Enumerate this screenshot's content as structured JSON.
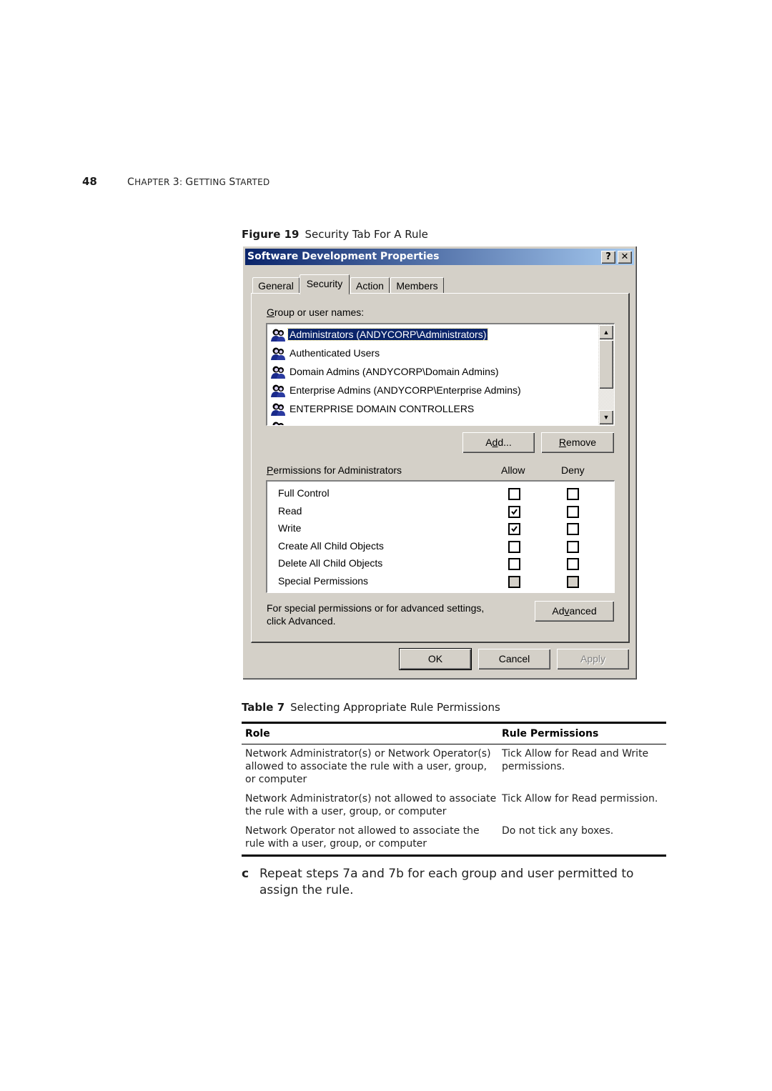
{
  "header": {
    "page_number": "48",
    "chapter_text": "Chapter 3: Getting Started"
  },
  "figure": {
    "label": "Figure 19",
    "title": "Security Tab For A Rule"
  },
  "dialog": {
    "title": "Software Development Properties",
    "help_button": "?",
    "close_button": "✕",
    "tabs": [
      {
        "label": "General",
        "active": false
      },
      {
        "label": "Security",
        "active": true
      },
      {
        "label": "Action",
        "active": false
      },
      {
        "label": "Members",
        "active": false
      }
    ],
    "group_label": "Group or user names:",
    "group_label_mnemonic": "G",
    "users": [
      {
        "name": "Administrators (ANDYCORP\\Administrators)",
        "selected": true,
        "icon": "user-group-icon"
      },
      {
        "name": "Authenticated Users",
        "selected": false,
        "icon": "user-group-icon"
      },
      {
        "name": "Domain Admins (ANDYCORP\\Domain Admins)",
        "selected": false,
        "icon": "user-group-icon"
      },
      {
        "name": "Enterprise Admins (ANDYCORP\\Enterprise Admins)",
        "selected": false,
        "icon": "user-group-icon"
      },
      {
        "name": "ENTERPRISE DOMAIN CONTROLLERS",
        "selected": false,
        "icon": "user-group-icon"
      }
    ],
    "add_button": "Add...",
    "remove_button": "Remove",
    "permissions_label": "Permissions for Administrators",
    "allow_header": "Allow",
    "deny_header": "Deny",
    "permissions": [
      {
        "name": "Full Control",
        "allow": "unchecked",
        "deny": "unchecked"
      },
      {
        "name": "Read",
        "allow": "checked",
        "deny": "unchecked"
      },
      {
        "name": "Write",
        "allow": "checked",
        "deny": "unchecked"
      },
      {
        "name": "Create All Child Objects",
        "allow": "unchecked",
        "deny": "unchecked"
      },
      {
        "name": "Delete All Child Objects",
        "allow": "unchecked",
        "deny": "unchecked"
      },
      {
        "name": "Special Permissions",
        "allow": "disabled",
        "deny": "disabled"
      }
    ],
    "advanced_hint_line1": "For special permissions or for advanced settings,",
    "advanced_hint_line2": "click Advanced.",
    "advanced_button": "Advanced",
    "ok_button": "OK",
    "cancel_button": "Cancel",
    "apply_button": "Apply",
    "apply_enabled": false,
    "colors": {
      "titlebar_start": "#0a246a",
      "titlebar_end": "#a6caf0",
      "face": "#d4d0c8",
      "selection": "#0a246a"
    }
  },
  "table": {
    "label": "Table 7",
    "title": "Selecting Appropriate Rule Permissions",
    "columns": [
      "Role",
      "Rule Permissions"
    ],
    "rows": [
      {
        "role": [
          "Network Administrator(s) or Network Operator(s)",
          "allowed to associate the rule with a user, group,",
          "or computer"
        ],
        "permissions": [
          "Tick Allow for Read and Write",
          "permissions."
        ]
      },
      {
        "role": [
          "Network Administrator(s) not allowed to associate",
          "the rule with a user, group, or computer"
        ],
        "permissions": [
          "Tick Allow for Read permission."
        ]
      },
      {
        "role": [
          "Network Operator not allowed to associate the",
          "rule with a user, group, or computer"
        ],
        "permissions": [
          "Do not tick any boxes."
        ]
      }
    ]
  },
  "step": {
    "letter": "c",
    "text": "Repeat steps 7a and 7b for each group and user permitted to assign the rule."
  }
}
